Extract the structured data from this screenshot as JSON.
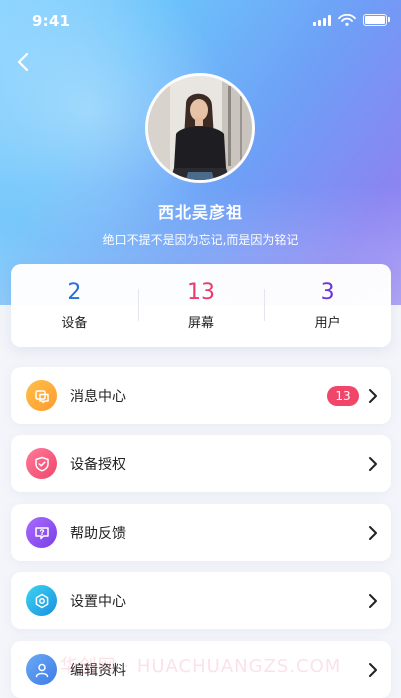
{
  "status_bar": {
    "time": "9:41"
  },
  "profile": {
    "name": "西北吴彦祖",
    "motto": "绝口不提不是因为忘记,而是因为铭记"
  },
  "stats": [
    {
      "value": "2",
      "label": "设备",
      "color": "#2a6fd6"
    },
    {
      "value": "13",
      "label": "屏幕",
      "color": "#ea3c6a"
    },
    {
      "value": "3",
      "label": "用户",
      "color": "#6b33d6"
    }
  ],
  "menu": [
    {
      "label": "消息中心",
      "icon": "message-icon",
      "badge": "13",
      "gradient": [
        "#ffc04a",
        "#ff9a2e"
      ]
    },
    {
      "label": "设备授权",
      "icon": "shield-icon",
      "badge": "",
      "gradient": [
        "#ff7a9a",
        "#f0466b"
      ]
    },
    {
      "label": "帮助反馈",
      "icon": "help-feedback-icon",
      "badge": "",
      "gradient": [
        "#a86cff",
        "#7a3fe6"
      ]
    },
    {
      "label": "设置中心",
      "icon": "settings-icon",
      "badge": "",
      "gradient": [
        "#3dd4f0",
        "#1a8fe0"
      ]
    },
    {
      "label": "编辑资料",
      "icon": "user-icon",
      "badge": "",
      "gradient": [
        "#6aaaf6",
        "#3d7be6"
      ]
    }
  ],
  "watermark": "华创网 · HUACHUANGZS.COM"
}
